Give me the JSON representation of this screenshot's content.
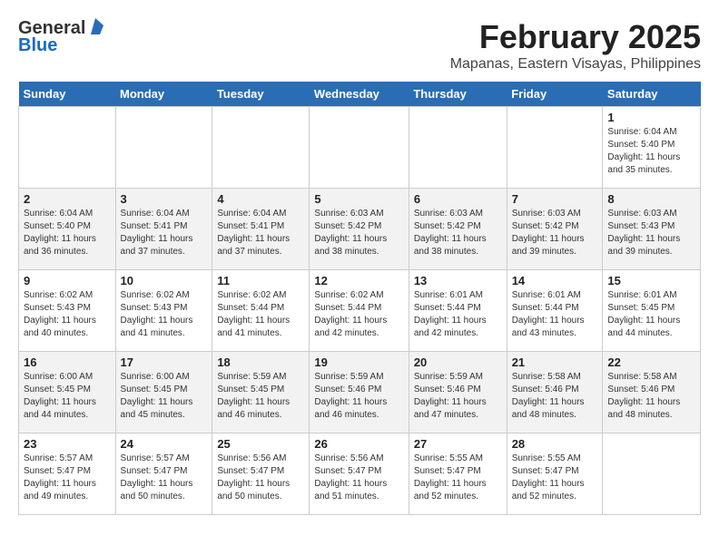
{
  "logo": {
    "general": "General",
    "blue": "Blue"
  },
  "title": {
    "month": "February 2025",
    "location": "Mapanas, Eastern Visayas, Philippines"
  },
  "weekdays": [
    "Sunday",
    "Monday",
    "Tuesday",
    "Wednesday",
    "Thursday",
    "Friday",
    "Saturday"
  ],
  "weeks": [
    [
      {
        "day": "",
        "info": ""
      },
      {
        "day": "",
        "info": ""
      },
      {
        "day": "",
        "info": ""
      },
      {
        "day": "",
        "info": ""
      },
      {
        "day": "",
        "info": ""
      },
      {
        "day": "",
        "info": ""
      },
      {
        "day": "1",
        "info": "Sunrise: 6:04 AM\nSunset: 5:40 PM\nDaylight: 11 hours and 35 minutes."
      }
    ],
    [
      {
        "day": "2",
        "info": "Sunrise: 6:04 AM\nSunset: 5:40 PM\nDaylight: 11 hours and 36 minutes."
      },
      {
        "day": "3",
        "info": "Sunrise: 6:04 AM\nSunset: 5:41 PM\nDaylight: 11 hours and 37 minutes."
      },
      {
        "day": "4",
        "info": "Sunrise: 6:04 AM\nSunset: 5:41 PM\nDaylight: 11 hours and 37 minutes."
      },
      {
        "day": "5",
        "info": "Sunrise: 6:03 AM\nSunset: 5:42 PM\nDaylight: 11 hours and 38 minutes."
      },
      {
        "day": "6",
        "info": "Sunrise: 6:03 AM\nSunset: 5:42 PM\nDaylight: 11 hours and 38 minutes."
      },
      {
        "day": "7",
        "info": "Sunrise: 6:03 AM\nSunset: 5:42 PM\nDaylight: 11 hours and 39 minutes."
      },
      {
        "day": "8",
        "info": "Sunrise: 6:03 AM\nSunset: 5:43 PM\nDaylight: 11 hours and 39 minutes."
      }
    ],
    [
      {
        "day": "9",
        "info": "Sunrise: 6:02 AM\nSunset: 5:43 PM\nDaylight: 11 hours and 40 minutes."
      },
      {
        "day": "10",
        "info": "Sunrise: 6:02 AM\nSunset: 5:43 PM\nDaylight: 11 hours and 41 minutes."
      },
      {
        "day": "11",
        "info": "Sunrise: 6:02 AM\nSunset: 5:44 PM\nDaylight: 11 hours and 41 minutes."
      },
      {
        "day": "12",
        "info": "Sunrise: 6:02 AM\nSunset: 5:44 PM\nDaylight: 11 hours and 42 minutes."
      },
      {
        "day": "13",
        "info": "Sunrise: 6:01 AM\nSunset: 5:44 PM\nDaylight: 11 hours and 42 minutes."
      },
      {
        "day": "14",
        "info": "Sunrise: 6:01 AM\nSunset: 5:44 PM\nDaylight: 11 hours and 43 minutes."
      },
      {
        "day": "15",
        "info": "Sunrise: 6:01 AM\nSunset: 5:45 PM\nDaylight: 11 hours and 44 minutes."
      }
    ],
    [
      {
        "day": "16",
        "info": "Sunrise: 6:00 AM\nSunset: 5:45 PM\nDaylight: 11 hours and 44 minutes."
      },
      {
        "day": "17",
        "info": "Sunrise: 6:00 AM\nSunset: 5:45 PM\nDaylight: 11 hours and 45 minutes."
      },
      {
        "day": "18",
        "info": "Sunrise: 5:59 AM\nSunset: 5:45 PM\nDaylight: 11 hours and 46 minutes."
      },
      {
        "day": "19",
        "info": "Sunrise: 5:59 AM\nSunset: 5:46 PM\nDaylight: 11 hours and 46 minutes."
      },
      {
        "day": "20",
        "info": "Sunrise: 5:59 AM\nSunset: 5:46 PM\nDaylight: 11 hours and 47 minutes."
      },
      {
        "day": "21",
        "info": "Sunrise: 5:58 AM\nSunset: 5:46 PM\nDaylight: 11 hours and 48 minutes."
      },
      {
        "day": "22",
        "info": "Sunrise: 5:58 AM\nSunset: 5:46 PM\nDaylight: 11 hours and 48 minutes."
      }
    ],
    [
      {
        "day": "23",
        "info": "Sunrise: 5:57 AM\nSunset: 5:47 PM\nDaylight: 11 hours and 49 minutes."
      },
      {
        "day": "24",
        "info": "Sunrise: 5:57 AM\nSunset: 5:47 PM\nDaylight: 11 hours and 50 minutes."
      },
      {
        "day": "25",
        "info": "Sunrise: 5:56 AM\nSunset: 5:47 PM\nDaylight: 11 hours and 50 minutes."
      },
      {
        "day": "26",
        "info": "Sunrise: 5:56 AM\nSunset: 5:47 PM\nDaylight: 11 hours and 51 minutes."
      },
      {
        "day": "27",
        "info": "Sunrise: 5:55 AM\nSunset: 5:47 PM\nDaylight: 11 hours and 52 minutes."
      },
      {
        "day": "28",
        "info": "Sunrise: 5:55 AM\nSunset: 5:47 PM\nDaylight: 11 hours and 52 minutes."
      },
      {
        "day": "",
        "info": ""
      }
    ]
  ]
}
